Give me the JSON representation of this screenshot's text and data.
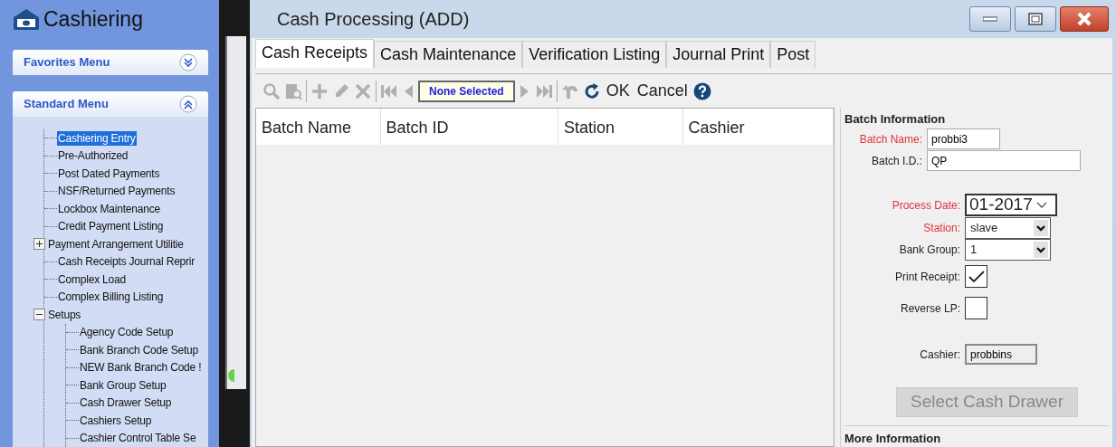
{
  "app": {
    "title": "Cashiering"
  },
  "menus": [
    {
      "title": "Favorites Menu",
      "expanded": false
    },
    {
      "title": "Standard Menu",
      "expanded": true
    }
  ],
  "tree": [
    {
      "label": "Cashiering Entry",
      "selected": true
    },
    {
      "label": "Pre-Authorized",
      "selected": false
    },
    {
      "label": "Post Dated Payments",
      "selected": false
    },
    {
      "label": "NSF/Returned Payments",
      "selected": false
    },
    {
      "label": "Lockbox Maintenance",
      "selected": false
    },
    {
      "label": "Credit Payment Listing",
      "selected": false
    },
    {
      "label": "Payment Arrangement Utilitie",
      "selected": false,
      "expanded": false
    },
    {
      "label": "Cash Receipts Journal Reprir",
      "selected": false
    },
    {
      "label": "Complex Load",
      "selected": false
    },
    {
      "label": "Complex Billing Listing",
      "selected": false
    },
    {
      "label": "Setups",
      "selected": false,
      "expanded": true,
      "children": [
        {
          "label": "Agency Code Setup",
          "selected": false
        },
        {
          "label": "Bank Branch Code Setup",
          "selected": false
        },
        {
          "label": "NEW Bank Branch Code !",
          "selected": false
        },
        {
          "label": "Bank Group Setup",
          "selected": false
        },
        {
          "label": "Cash Drawer Setup",
          "selected": false
        },
        {
          "label": "Cashiers Setup",
          "selected": false
        },
        {
          "label": "Cashier Control Table Se",
          "selected": false
        }
      ]
    }
  ],
  "window": {
    "title": "Cash Processing (ADD)"
  },
  "tabs": [
    {
      "label": "Cash Receipts",
      "selected": true
    },
    {
      "label": "Cash Maintenance",
      "selected": false
    },
    {
      "label": "Verification Listing",
      "selected": false
    },
    {
      "label": "Journal Print",
      "selected": false
    },
    {
      "label": "Post",
      "selected": false
    }
  ],
  "toolbar": {
    "tools": [
      {
        "disabled": true
      },
      {
        "disabled": true
      },
      {
        "disabled": true
      },
      {
        "disabled": true
      },
      {
        "disabled": true
      },
      {
        "disabled": true
      },
      {
        "disabled": true
      },
      {
        "disabled": true
      },
      {
        "disabled": true
      },
      {
        "disabled": true
      },
      {
        "disabled": false
      }
    ],
    "selection": "None Selected",
    "buttons": [
      "OK",
      "Cancel"
    ]
  },
  "table": {
    "columns": [
      "Batch Name",
      "Batch ID",
      "Station",
      "Cashier"
    ]
  },
  "batch_information": {
    "title": "Batch Information",
    "fields": [
      {
        "label": "Batch Name:",
        "kind": "text",
        "required": true,
        "value": "probbi3",
        "wide": false
      },
      {
        "label": "Batch I.D.:",
        "kind": "text",
        "required": false,
        "value": "QP",
        "wide": true
      }
    ],
    "settings": [
      {
        "label": "Process Date:",
        "kind": "date",
        "required": true,
        "value": "01-2017"
      },
      {
        "label": "Station:",
        "kind": "select",
        "required": true,
        "value": "slave"
      },
      {
        "label": "Bank Group:",
        "kind": "select",
        "required": false,
        "value": "1"
      },
      {
        "label": "Print Receipt:",
        "kind": "checkbox",
        "required": false,
        "checked": true
      },
      {
        "label": "Reverse LP:",
        "kind": "checkbox",
        "required": false,
        "checked": false
      },
      {
        "label": "Cashier:",
        "kind": "readonly",
        "required": false,
        "value": "probbins"
      }
    ],
    "button": {
      "label": "Select Cash Drawer",
      "disabled": true
    }
  },
  "more_information": {
    "title": "More Information"
  }
}
